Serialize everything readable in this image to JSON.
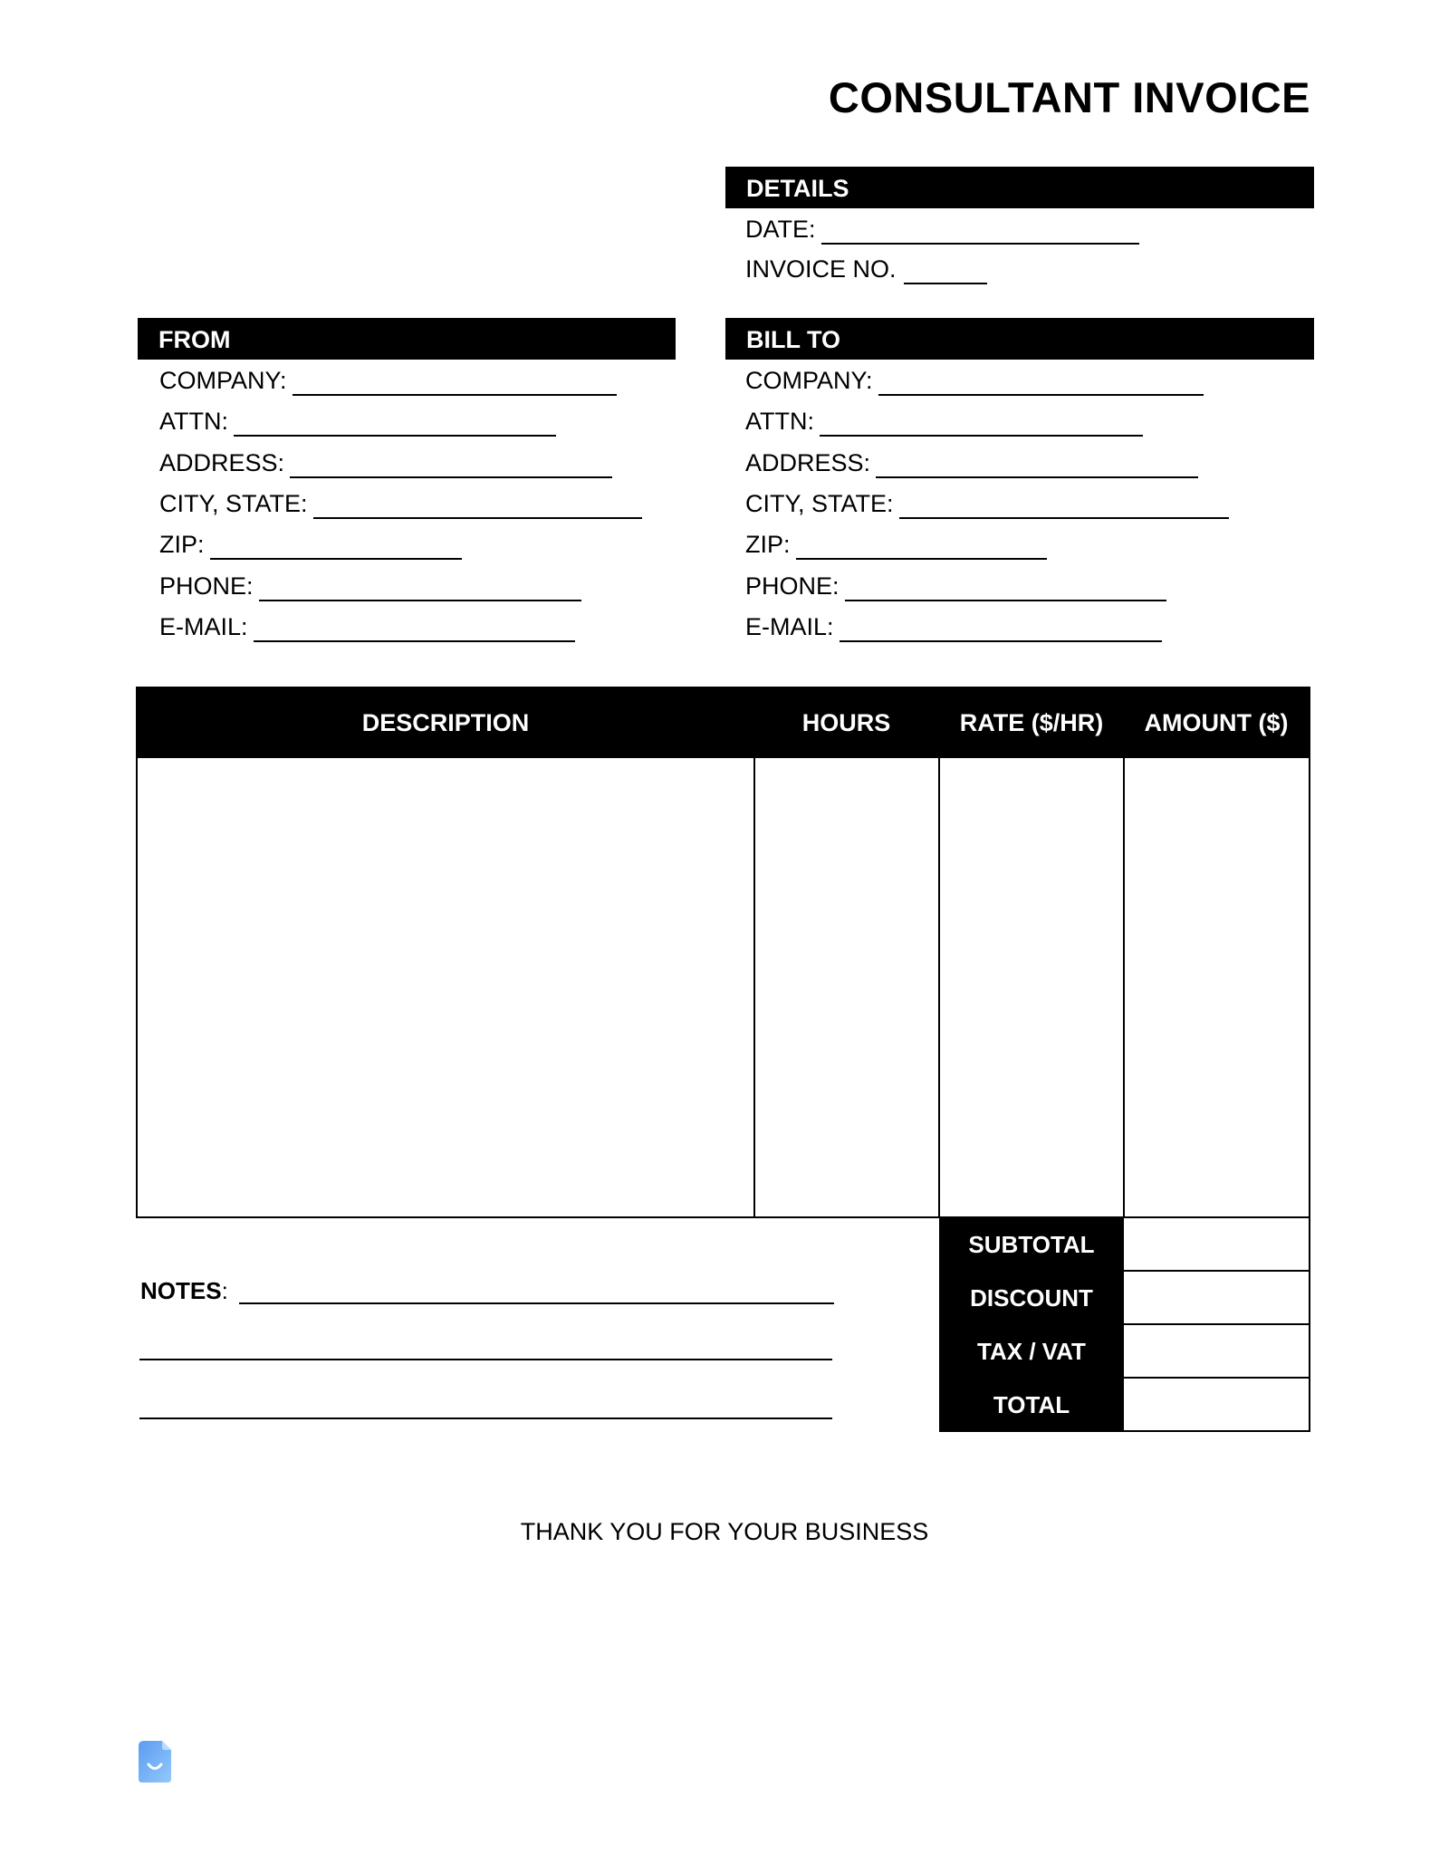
{
  "title": "CONSULTANT INVOICE",
  "details": {
    "header": "DETAILS",
    "fields": [
      {
        "label": "DATE:",
        "value": ""
      },
      {
        "label": "INVOICE NO.",
        "value": ""
      }
    ]
  },
  "from": {
    "header": "FROM",
    "fields": [
      {
        "label": "COMPANY:",
        "value": ""
      },
      {
        "label": "ATTN:",
        "value": ""
      },
      {
        "label": "ADDRESS:",
        "value": ""
      },
      {
        "label": "CITY, STATE:",
        "value": ""
      },
      {
        "label": "ZIP:",
        "value": ""
      },
      {
        "label": "PHONE:",
        "value": ""
      },
      {
        "label": "E-MAIL:",
        "value": ""
      }
    ]
  },
  "bill_to": {
    "header": "BILL TO",
    "fields": [
      {
        "label": "COMPANY:",
        "value": ""
      },
      {
        "label": "ATTN:",
        "value": ""
      },
      {
        "label": "ADDRESS:",
        "value": ""
      },
      {
        "label": "CITY, STATE:",
        "value": ""
      },
      {
        "label": "ZIP:",
        "value": ""
      },
      {
        "label": "PHONE:",
        "value": ""
      },
      {
        "label": "E-MAIL:",
        "value": ""
      }
    ]
  },
  "table": {
    "columns": [
      "DESCRIPTION",
      "HOURS",
      "RATE ($/HR)",
      "AMOUNT ($)"
    ],
    "rows": []
  },
  "totals": [
    {
      "label": "SUBTOTAL",
      "value": ""
    },
    {
      "label": "DISCOUNT",
      "value": ""
    },
    {
      "label": "TAX / VAT",
      "value": ""
    },
    {
      "label": "TOTAL",
      "value": ""
    }
  ],
  "notes": {
    "label": "NOTES",
    "colon": ":",
    "value": ""
  },
  "footer": {
    "thanks": "THANK YOU FOR YOUR BUSINESS"
  },
  "logo": {
    "icon": "document-smile-icon",
    "color": "#6aa8f5"
  }
}
